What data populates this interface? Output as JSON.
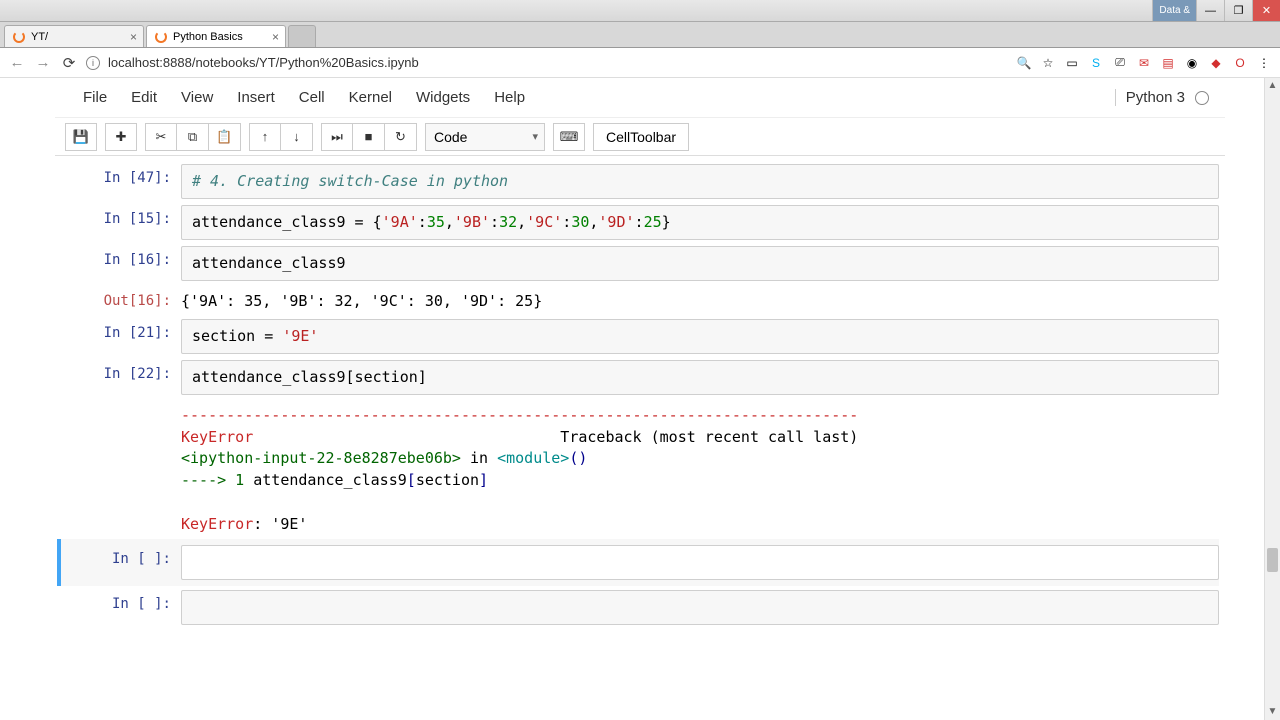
{
  "titlebar": {
    "data_label": "Data &",
    "min": "—",
    "max": "❐",
    "close": "✕"
  },
  "tabs": [
    {
      "title": "YT/",
      "active": false
    },
    {
      "title": "Python Basics",
      "active": true
    }
  ],
  "address": {
    "url": "localhost:8888/notebooks/YT/Python%20Basics.ipynb"
  },
  "ext_icons": {
    "zoom": "🔍",
    "star": "☆",
    "box": "▭",
    "skype": "S",
    "cast": "⎚",
    "mail": "✉",
    "pdf": "▤",
    "maps": "◉",
    "db": "◆",
    "opera": "O",
    "menu": "⋮"
  },
  "menubar": {
    "items": [
      "File",
      "Edit",
      "View",
      "Insert",
      "Cell",
      "Kernel",
      "Widgets",
      "Help"
    ],
    "kernel": "Python 3"
  },
  "toolbar": {
    "save": "💾",
    "add": "✚",
    "cut": "✂",
    "copy": "⧉",
    "paste": "📋",
    "up": "↑",
    "down": "↓",
    "run": "⏭",
    "stop": "■",
    "restart": "↻",
    "celltype": "Code",
    "keyboard": "⌨",
    "celltoolbar": "CellToolbar"
  },
  "cells": [
    {
      "in": "In [47]:",
      "code_html": "<span class='c-comment'># 4. Creating switch-Case in python</span>"
    },
    {
      "in": "In [15]:",
      "code_html": "attendance_class9 = {<span class='c-str'>'9A'</span>:<span class='c-num'>35</span>,<span class='c-str'>'9B'</span>:<span class='c-num'>32</span>,<span class='c-str'>'9C'</span>:<span class='c-num'>30</span>,<span class='c-str'>'9D'</span>:<span class='c-num'>25</span>}"
    },
    {
      "in": "In [16]:",
      "code_html": "attendance_class9",
      "out": "Out[16]:",
      "out_text": "{'9A': 35, '9B': 32, '9C': 30, '9D': 25}"
    },
    {
      "in": "In [21]:",
      "code_html": "section = <span class='c-str'>'9E'</span>"
    },
    {
      "in": "In [22]:",
      "code_html": "attendance_class9[section]",
      "err_html": "<span class='e-red'>---------------------------------------------------------------------------</span>\n<span class='e-red'>KeyError</span>                                  Traceback (most recent call last)\n<span class='e-green'>&lt;ipython-input-22-8e8287ebe06b&gt;</span> in <span class='e-cyan'>&lt;module&gt;</span><span class='e-blue'>()</span>\n<span class='e-green'>----&gt; 1</span> attendance_class9<span class='e-blue'>[</span>section<span class='e-blue'>]</span>\n\n<span class='e-red'>KeyError</span>: '9E'"
    },
    {
      "in": "In [ ]:",
      "code_html": "",
      "selected": true
    },
    {
      "in": "In [ ]:",
      "code_html": ""
    }
  ]
}
